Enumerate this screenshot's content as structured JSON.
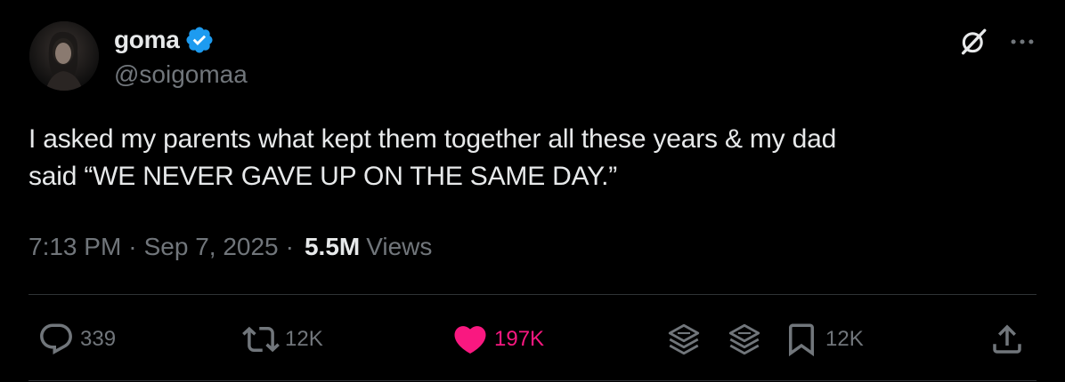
{
  "author": {
    "display_name": "goma",
    "handle": "@soigomaa",
    "verified": true,
    "verified_color": "#1d9bf0"
  },
  "tweet": {
    "lines": [
      "I asked my parents what kept them together all these years & my dad",
      "said “WE NEVER GAVE UP ON THE SAME DAY.”"
    ],
    "time": "7:13 PM",
    "date": "Sep 7, 2025",
    "separator": "·",
    "views_count": "5.5M",
    "views_label": "Views"
  },
  "actions": {
    "replies": "339",
    "reposts": "12K",
    "likes": "197K",
    "bookmarks": "12K",
    "like_color": "#f91880"
  },
  "icons": [
    "grok-icon",
    "more-icon",
    "reply-icon",
    "repost-icon",
    "like-icon",
    "layers-icon",
    "bookmark-icon",
    "share-icon"
  ]
}
